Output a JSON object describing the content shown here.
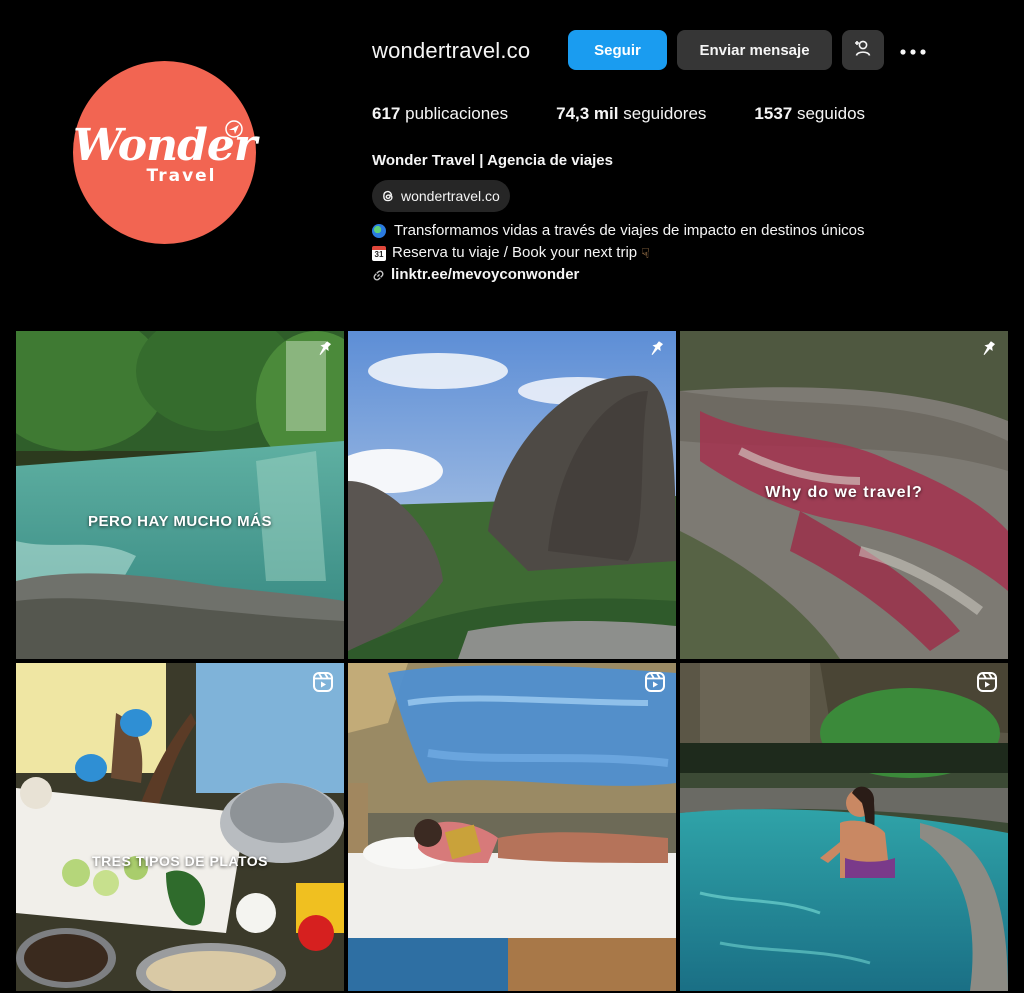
{
  "profile": {
    "username": "wondertravel.co",
    "avatar_logo_main": "Wonder",
    "avatar_logo_sub": "Travel",
    "full_name": "Wonder Travel | Agencia de viajes",
    "threads_handle": "wondertravel.co"
  },
  "actions": {
    "follow_label": "Seguir",
    "message_label": "Enviar mensaje",
    "suggest_icon": "person-plus-icon",
    "more_icon": "more-horizontal-icon"
  },
  "stats": {
    "posts_count": "617",
    "posts_label": "publicaciones",
    "followers_count": "74,3 mil",
    "followers_label": "seguidores",
    "following_count": "1537",
    "following_label": "seguidos"
  },
  "bio": {
    "line1": "Transformamos vidas a través de viajes de impacto en destinos únicos",
    "line2": "Reserva tu viaje / Book your next trip",
    "line2_calendar_day": "31",
    "link": "linktr.ee/mevoyconwonder"
  },
  "posts": [
    {
      "overlay": "PERO HAY MUCHO MÁS",
      "badge": "pin-icon"
    },
    {
      "overlay": "",
      "badge": "pin-icon"
    },
    {
      "overlay": "Why do we travel?",
      "badge": "pin-icon"
    },
    {
      "overlay": "TRES TIPOS DE PLATOS",
      "badge": "reel-icon"
    },
    {
      "overlay": "",
      "badge": "reel-icon"
    },
    {
      "overlay": "",
      "badge": "reel-icon"
    }
  ],
  "colors": {
    "background": "#000000",
    "follow_button": "#1a9cf0",
    "secondary_button": "#363636",
    "avatar": "#f26552"
  }
}
